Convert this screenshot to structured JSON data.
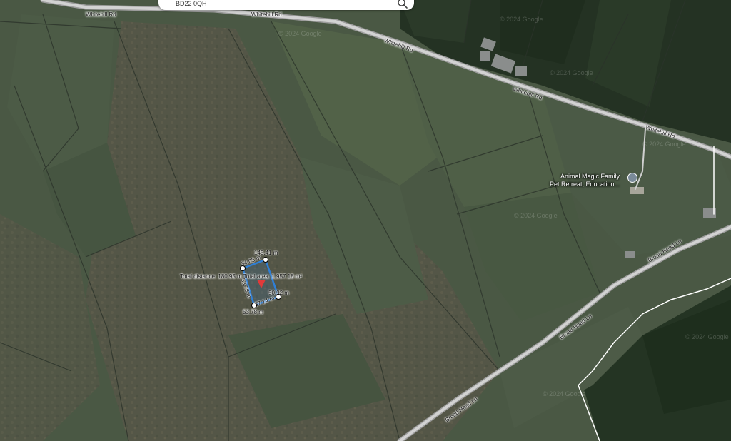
{
  "search": {
    "query": "BD22 0QH"
  },
  "roads": {
    "whitehill_rd_1": "Whitehill Rd",
    "whitehill_rd_2": "Whitehill Rd",
    "whitehill_rd_3": "Whitehill Rd",
    "whitehill_rd_4": "Whitehill Rd",
    "broad_head_ln_1": "Broad Head Ln",
    "broad_head_ln_2": "Broad Head Ln",
    "broad_head_ln_3": "Broad Head Ln"
  },
  "poi": {
    "line1": "Animal Magic Family",
    "line2": "Pet Retreat, Education..."
  },
  "measurement": {
    "summary": "Total distance: 180.95 m Total area: 1,957.18 m²",
    "top_edge": "145.41 m",
    "top_left_edge": "34.05 m",
    "right_edge_outer": "50",
    "right_edge": "50.92 m",
    "left_edge": "53.78 m",
    "bottom_edge": "57.14 m",
    "bottom": "53.78 m"
  },
  "colors": {
    "field_dark": "#2f3d2d",
    "field_mid": "#4a5a45",
    "moor": "#5a5848",
    "road": "#c8c8c8",
    "measure_line": "#2f7fd6",
    "pin": "#e03a3a"
  }
}
